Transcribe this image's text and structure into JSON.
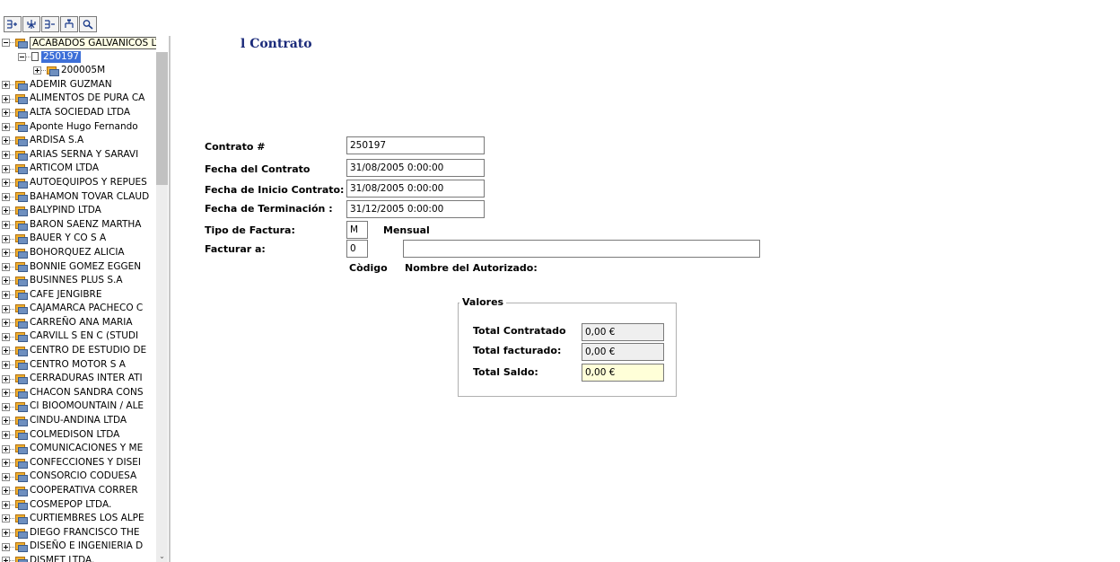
{
  "toolbar": {
    "buttons": [
      {
        "icon": "expand-all-icon"
      },
      {
        "icon": "filter-tree-icon"
      },
      {
        "icon": "collapse-all-icon"
      },
      {
        "icon": "hierarchy-icon"
      },
      {
        "icon": "search-icon"
      }
    ]
  },
  "tree": {
    "root_label": "ACABADOS GALVANICOS LTDA",
    "selected_contract": "250197",
    "child_item": "200005M",
    "items": [
      "ADEMIR GUZMAN",
      "ALIMENTOS DE PURA CA",
      "ALTA SOCIEDAD LTDA",
      "Aponte Hugo Fernando",
      "ARDISA S.A",
      "ARIAS SERNA Y SARAVI",
      "ARTICOM LTDA",
      "AUTOEQUIPOS Y REPUES",
      "BAHAMON TOVAR CLAUD",
      "BALYPIND LTDA",
      "BARON SAENZ MARTHA",
      "BAUER Y CO S A",
      "BOHORQUEZ ALICIA",
      "BONNIE GOMEZ EGGEN",
      "BUSINNES PLUS S.A",
      "CAFE JENGIBRE",
      "CAJAMARCA PACHECO C",
      "CARREÑO ANA MARIA",
      "CARVILL S EN C (STUDI",
      "CENTRO DE ESTUDIO DE",
      "CENTRO MOTOR S A",
      "CERRADURAS INTER ATI",
      "CHACON SANDRA CONS",
      "CI BIOOMOUNTAIN / ALE",
      "CINDU-ANDINA LTDA",
      "COLMEDISON LTDA",
      "COMUNICACIONES Y ME",
      "CONFECCIONES Y DISEI",
      "CONSORCIO CODUESA",
      "COOPERATIVA CORRER",
      "COSMEPOP LTDA.",
      "CURTIEMBRES LOS ALPE",
      "DIEGO FRANCISCO THE",
      "DISEÑO E INGENIERIA D",
      "DISMET LTDA."
    ]
  },
  "page": {
    "title": "l Contrato"
  },
  "form": {
    "contrato_label": "Contrato #",
    "contrato_value": "250197",
    "fecha_contrato_label": "Fecha del Contrato",
    "fecha_contrato_value": "31/08/2005 0:00:00",
    "fecha_inicio_label": "Fecha de Inicio Contrato:",
    "fecha_inicio_value": "31/08/2005 0:00:00",
    "fecha_terminacion_label": "Fecha de Terminación :",
    "fecha_terminacion_value": "31/12/2005 0:00:00",
    "tipo_factura_label": "Tipo de Factura:",
    "tipo_factura_value": "M",
    "tipo_factura_desc": "Mensual",
    "facturar_label": "Facturar a:",
    "facturar_codigo_value": "0",
    "facturar_nombre_value": "",
    "codigo_caption": "Còdigo",
    "nombre_caption": "Nombre del Autorizado:"
  },
  "valores": {
    "legend": "Valores",
    "total_contratado_label": "Total Contratado",
    "total_contratado_value": "0,00 €",
    "total_facturado_label": "Total facturado:",
    "total_facturado_value": "0,00 €",
    "total_saldo_label": "Total Saldo:",
    "total_saldo_value": "0,00 €"
  }
}
